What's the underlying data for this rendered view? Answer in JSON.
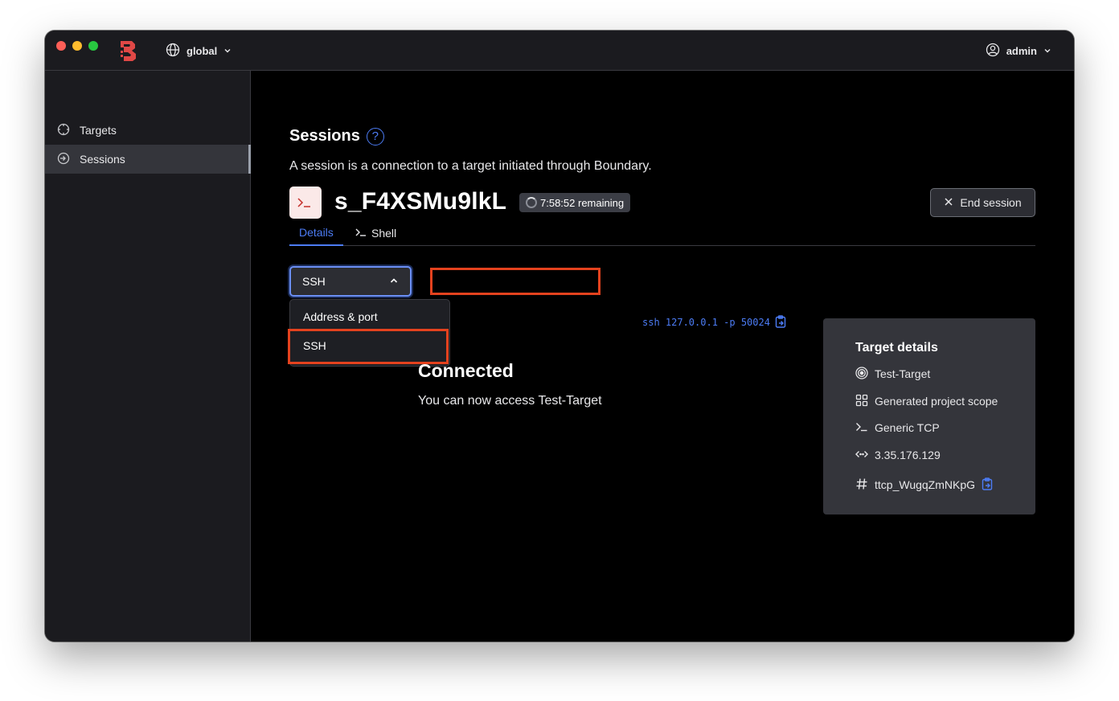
{
  "header": {
    "scope_label": "global",
    "user_label": "admin"
  },
  "sidebar": {
    "items": [
      {
        "label": "Targets",
        "icon": "crosshair-icon"
      },
      {
        "label": "Sessions",
        "icon": "sign-in-icon",
        "active": true
      }
    ]
  },
  "page": {
    "title": "Sessions",
    "description": "A session is a connection to a target initiated through Boundary."
  },
  "session": {
    "id": "s_F4XSMu9lkL",
    "remaining": "7:58:52 remaining",
    "end_button_label": "End session"
  },
  "tabs": [
    {
      "label": "Details",
      "active": true
    },
    {
      "label": "Shell",
      "active": false
    }
  ],
  "connection": {
    "selected_method": "SSH",
    "options": [
      "Address & port",
      "SSH"
    ],
    "command": "ssh 127.0.0.1 -p 50024",
    "status_title": "Connected",
    "status_text": "You can now access Test-Target"
  },
  "target_details": {
    "title": "Target details",
    "name": "Test-Target",
    "scope": "Generated project scope",
    "type": "Generic TCP",
    "address": "3.35.176.129",
    "id": "ttcp_WugqZmNKpG"
  },
  "colors": {
    "accent": "#4c7cf5",
    "highlight": "#e4421e",
    "brand": "#e04846"
  }
}
